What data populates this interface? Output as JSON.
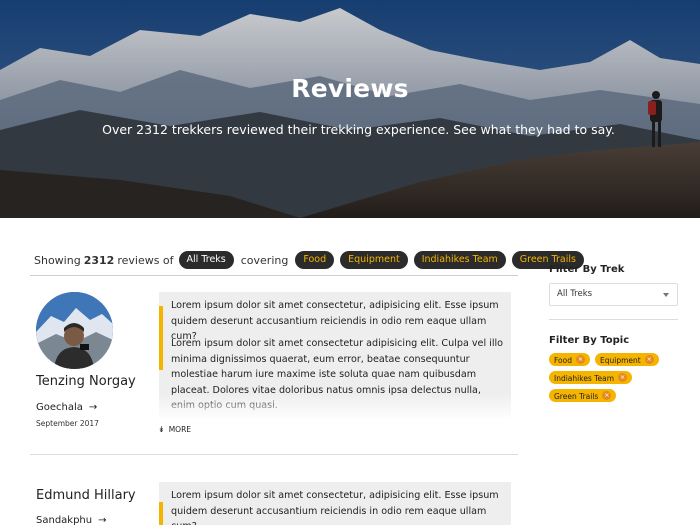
{
  "hero": {
    "title": "Reviews",
    "subtitle": "Over 2312 trekkers reviewed their trekking experience. See what they had to say."
  },
  "showing": {
    "prefix": "Showing",
    "count": "2312",
    "middle": "reviews of",
    "trek_pill": "All Treks",
    "covering": "covering",
    "topic_pills": [
      "Food",
      "Equipment",
      "Indiahikes Team",
      "Green Trails"
    ]
  },
  "reviews": [
    {
      "name": "Tenzing Norgay",
      "trek": "Goechala",
      "date": "September 2017",
      "paragraphs": [
        "Lorem ipsum dolor sit amet consectetur, adipisicing elit. Esse ipsum quidem deserunt accusantium reiciendis in odio rem eaque ullam cum?",
        "Lorem ipsum dolor sit amet consectetur adipisicing elit. Culpa vel illo minima dignissimos quaerat, eum error, beatae consequuntur molestiae harum iure maxime iste soluta quae nam quibusdam placeat. Dolores vitae doloribus natus omnis ipsa delectus nulla, enim optio cum quasi."
      ],
      "more_label": "MORE"
    },
    {
      "name": "Edmund Hillary",
      "trek": "Sandakphu",
      "paragraphs": [
        "Lorem ipsum dolor sit amet consectetur, adipisicing elit. Esse ipsum quidem deserunt accusantium reiciendis in odio rem eaque ullam cum?"
      ]
    }
  ],
  "sidebar": {
    "filter_trek_title": "Filter By Trek",
    "trek_select_value": "All Treks",
    "filter_topic_title": "Filter By Topic",
    "topic_tags": [
      "Food",
      "Equipment",
      "Indiahikes Team",
      "Green Trails"
    ],
    "remove_glyph": "×"
  },
  "colors": {
    "accent": "#f5b400",
    "pill_bg": "#2b2b2b",
    "tag_close": "#e58a1f"
  },
  "icons": {
    "trek_arrow": "→",
    "more_chevron": "»",
    "select_caret": "caret-down-icon"
  }
}
